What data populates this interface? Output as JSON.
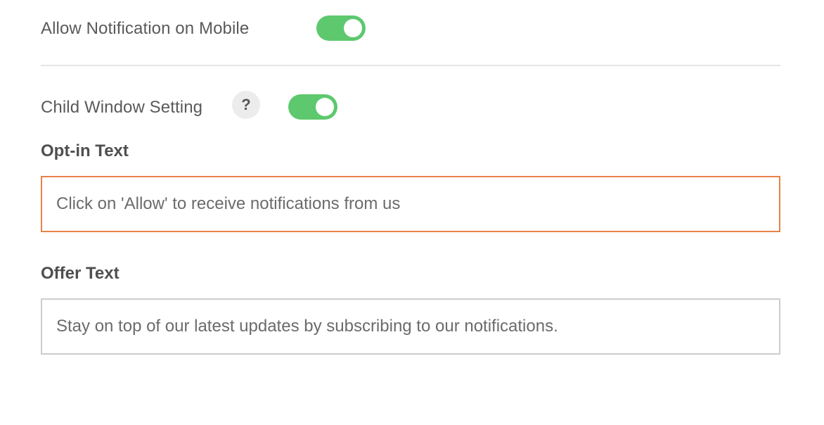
{
  "mobile_notification": {
    "label": "Allow Notification on Mobile",
    "enabled": true
  },
  "child_window": {
    "label": "Child Window Setting",
    "help_glyph": "?",
    "enabled": true
  },
  "opt_in": {
    "label": "Opt-in Text",
    "value": "Click on 'Allow' to receive notifications from us"
  },
  "offer": {
    "label": "Offer Text",
    "value": "Stay on top of our latest updates by subscribing to our notifications."
  },
  "colors": {
    "toggle_on": "#5dc86e",
    "focus_border": "#e8824a",
    "input_border": "#cccccc"
  }
}
